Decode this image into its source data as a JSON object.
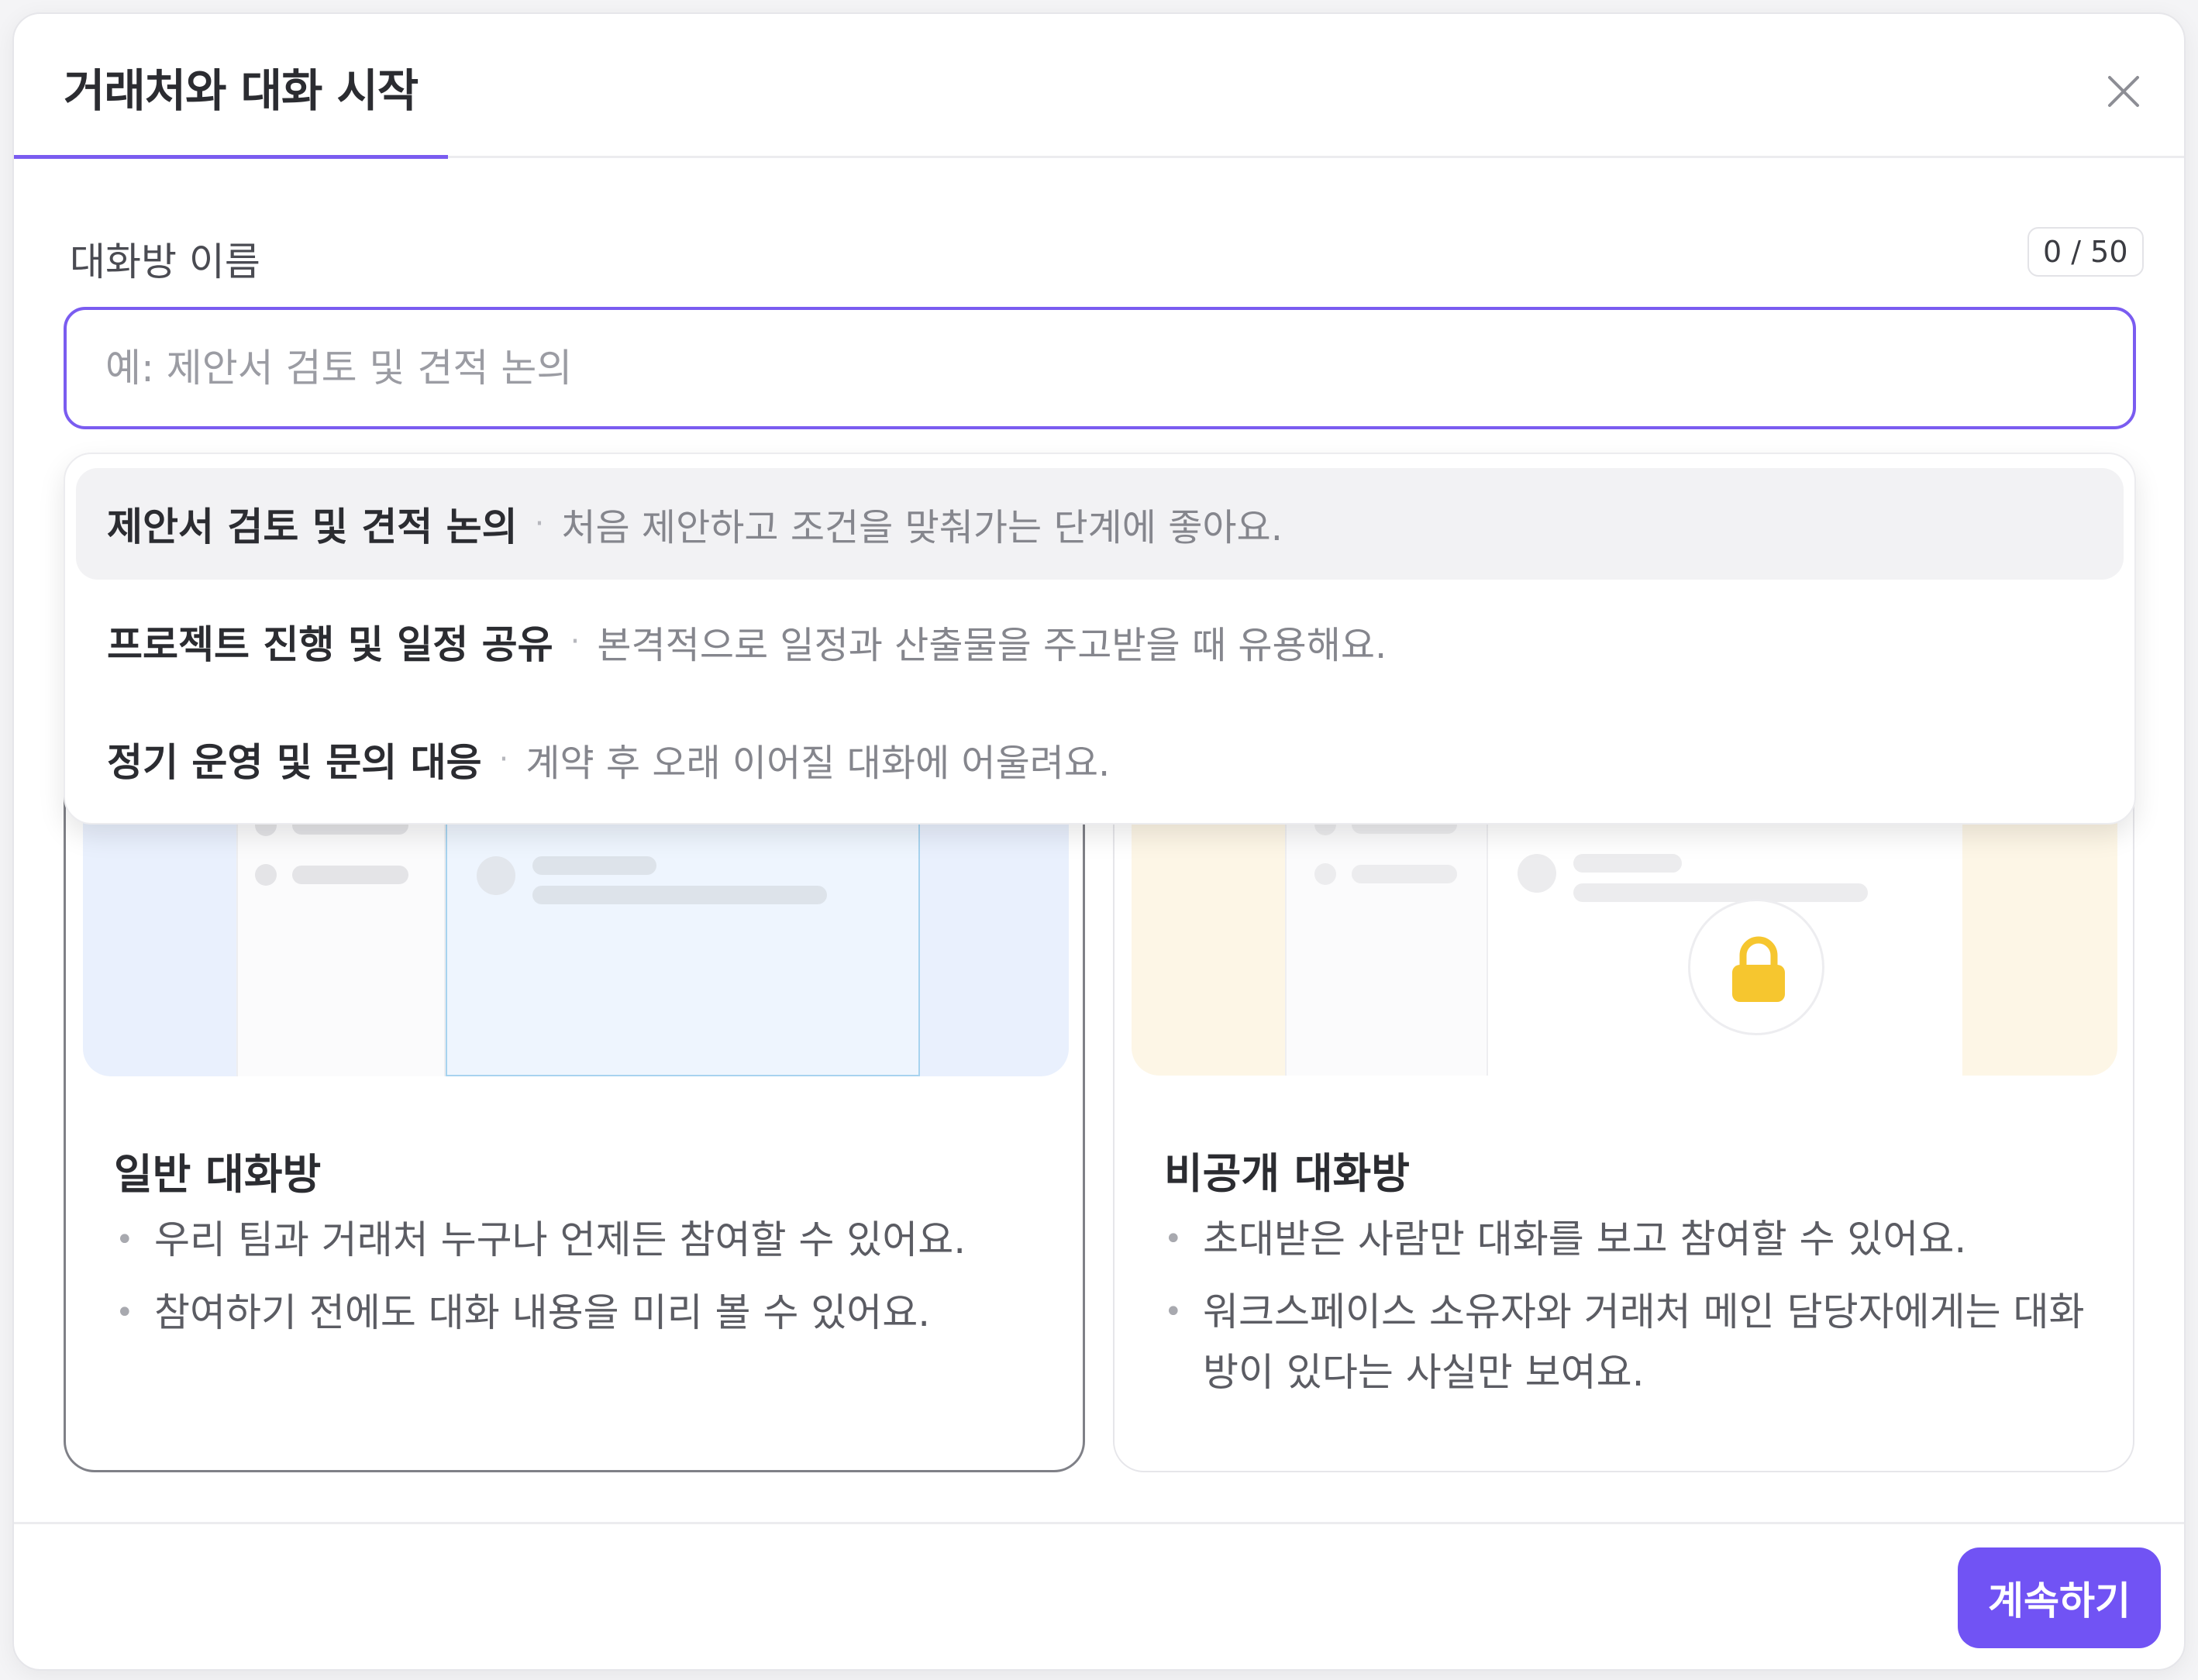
{
  "modal": {
    "title": "거래처와 대화 시작"
  },
  "field": {
    "label": "대화방 이름",
    "counter": "0 / 50",
    "placeholder": "예: 제안서 검토 및 견적 논의",
    "value": ""
  },
  "suggestions": [
    {
      "name": "제안서 검토 및 견적 논의",
      "separator": "·",
      "description": "처음 제안하고 조건을 맞춰가는 단계에 좋아요."
    },
    {
      "name": "프로젝트 진행 및 일정 공유",
      "separator": "·",
      "description": "본격적으로 일정과 산출물을 주고받을 때 유용해요."
    },
    {
      "name": "정기 운영 및 문의 대응",
      "separator": "·",
      "description": "계약 후 오래 이어질 대화에 어울려요."
    }
  ],
  "cards": [
    {
      "title": "일반 대화방",
      "bullets": [
        "우리 팀과 거래처 누구나 언제든 참여할 수 있어요.",
        "참여하기 전에도 대화 내용을 미리 볼 수 있어요."
      ]
    },
    {
      "title": "비공개 대화방",
      "bullets": [
        "초대받은 사람만 대화를 보고 참여할 수 있어요.",
        "워크스페이스 소유자와 거래처 메인 담당자에게는 대화방이 있다는 사실만 보여요."
      ]
    }
  ],
  "footer": {
    "continue_label": "계속하기"
  },
  "icons": {
    "close": "close-icon",
    "lock": "lock-icon"
  },
  "colors": {
    "accent": "#7153f4",
    "lock": "#f6c62f"
  }
}
